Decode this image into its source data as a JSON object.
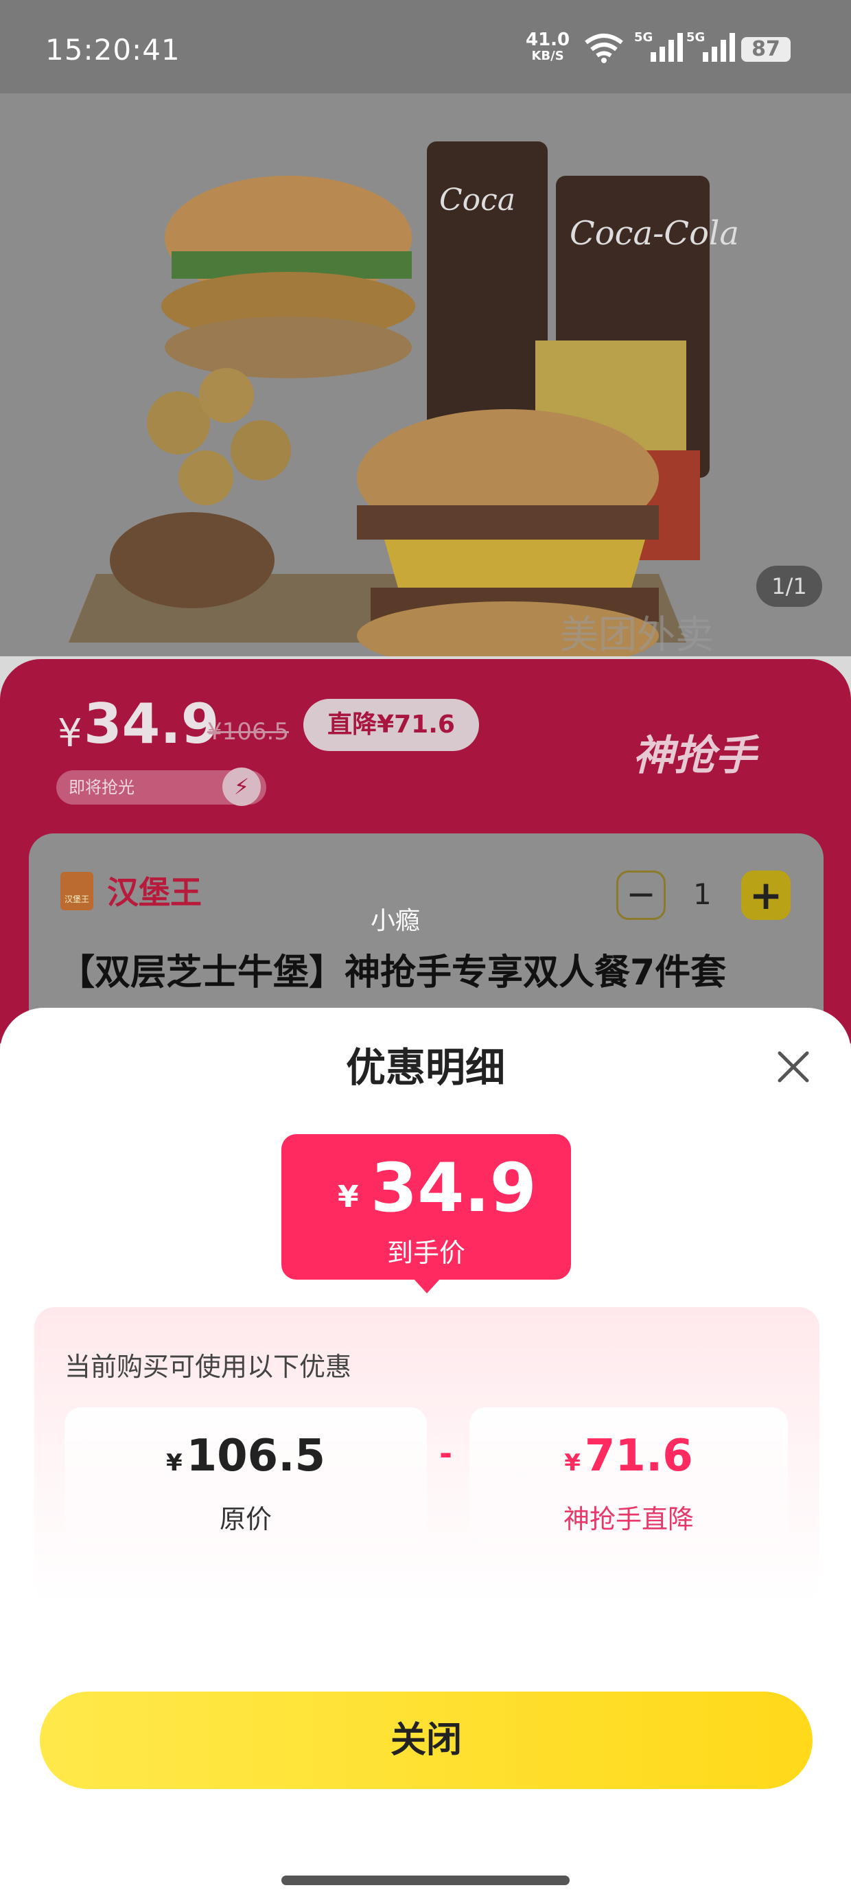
{
  "status_bar": {
    "time": "15:20:41",
    "net_speed": "41.0",
    "net_speed_unit": "KB/S",
    "signal1": "5G",
    "signal2": "5G",
    "battery": "87"
  },
  "hero": {
    "pager": "1/1",
    "watermark": "美团外卖"
  },
  "promo": {
    "currency": "¥",
    "price": "34.9",
    "original_price": "¥106.5",
    "drop_badge": "直降¥71.6",
    "soon_label": "即将抢光",
    "brand": "神抢手"
  },
  "shop": {
    "name": "汉堡王",
    "logo_text": "汉堡王",
    "user": "小瘾",
    "quantity": "1",
    "minus": "−",
    "plus": "+",
    "product_title": "【双层芝士牛堡】神抢手专享双人餐7件套"
  },
  "sheet": {
    "title": "优惠明细",
    "final_currency": "¥",
    "final_price": "34.9",
    "final_label": "到手价",
    "hint": "当前购买可使用以下优惠",
    "original": {
      "currency": "¥",
      "value": "106.5",
      "label": "原价"
    },
    "operator": "-",
    "discount": {
      "currency": "¥",
      "value": "71.6",
      "label": "神抢手直降"
    },
    "close_button": "关闭"
  },
  "colors": {
    "accent_red": "#ff2a5f",
    "promo_bg": "#a8163f",
    "button_yellow": "#ffd91a"
  }
}
